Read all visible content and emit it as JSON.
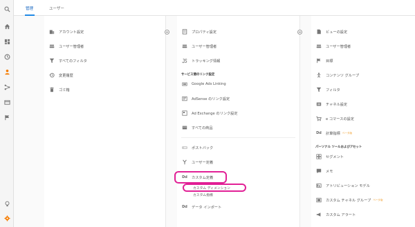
{
  "tabs": {
    "admin": "管理",
    "user": "ユーザー"
  },
  "col1": {
    "items": [
      "アカウント設定",
      "ユーザー管理者",
      "すべてのフィルタ",
      "変更履歴",
      "ゴミ箱"
    ]
  },
  "col2": {
    "items_top": [
      "プロパティ設定",
      "ユーザー管理者",
      "トラッキング情報"
    ],
    "section_link": "サービス間のリンク設定",
    "links": [
      "Google Ads Linking",
      "AdSense のリンク設定",
      "Ad Exchange のリンク設定",
      "すべての商品"
    ],
    "items_bottom": [
      "ポストバック",
      "ユーザー定義",
      "カスタム定義"
    ],
    "sub_items": [
      "カスタム ディメンション",
      "カスタム指標"
    ],
    "data_import": "データ インポート",
    "dd": "Dd"
  },
  "col3": {
    "items": [
      "ビューの設定",
      "ユーザー管理者",
      "目標",
      "コンテンツ グループ",
      "フィルタ",
      "チャネル設定",
      "e コマースの設定",
      "計算指標"
    ],
    "beta": "ベータ版",
    "section": "パーソナル ツールおよびアセット",
    "tools": [
      "セグメント",
      "メモ",
      "アトリビューション モデル",
      "カスタム チャネル グループ",
      "カスタム アラート"
    ],
    "dd": "Dd"
  },
  "colors": {
    "accent": "#1e88e5",
    "highlight": "#e11f95",
    "active_rail": "#f57c00",
    "settings": "#f57c00"
  }
}
